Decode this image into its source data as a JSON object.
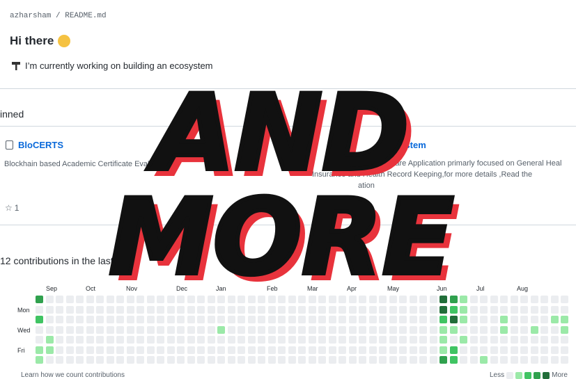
{
  "readme": {
    "path": "azharsham / README.md",
    "greeting": "Hi there",
    "line1": "I’m currently working on building an ecosystem"
  },
  "pinned": {
    "heading": "inned",
    "repos": [
      {
        "name": "BloCERTS",
        "description": "Blockhain based Academic Certificate Evaluation",
        "stars": "1"
      },
      {
        "name": "areSystem",
        "description_lines": [
          "ealthcare Application primarly focused on General Heal",
          "Insurance and Health Record Keeping,for more details ,Read the",
          "ation"
        ]
      }
    ]
  },
  "contributions": {
    "heading": "12 contributions in the last yea",
    "months": [
      "Sep",
      "Oct",
      "Nov",
      "Dec",
      "Jan",
      "Feb",
      "Mar",
      "Apr",
      "May",
      "Jun",
      "Jul",
      "Aug"
    ],
    "days": [
      "Mon",
      "Wed",
      "Fri"
    ],
    "learn_text": "Learn how we count contributions",
    "legend_less": "Less",
    "legend_more": "More",
    "colors": [
      "#ebedf0",
      "#9be9a8",
      "#40c463",
      "#30a14e",
      "#216e39"
    ]
  },
  "overlay": {
    "line1": "AND",
    "line2": "MORE",
    "fill": "#111111",
    "shadow": "#e8333c"
  }
}
